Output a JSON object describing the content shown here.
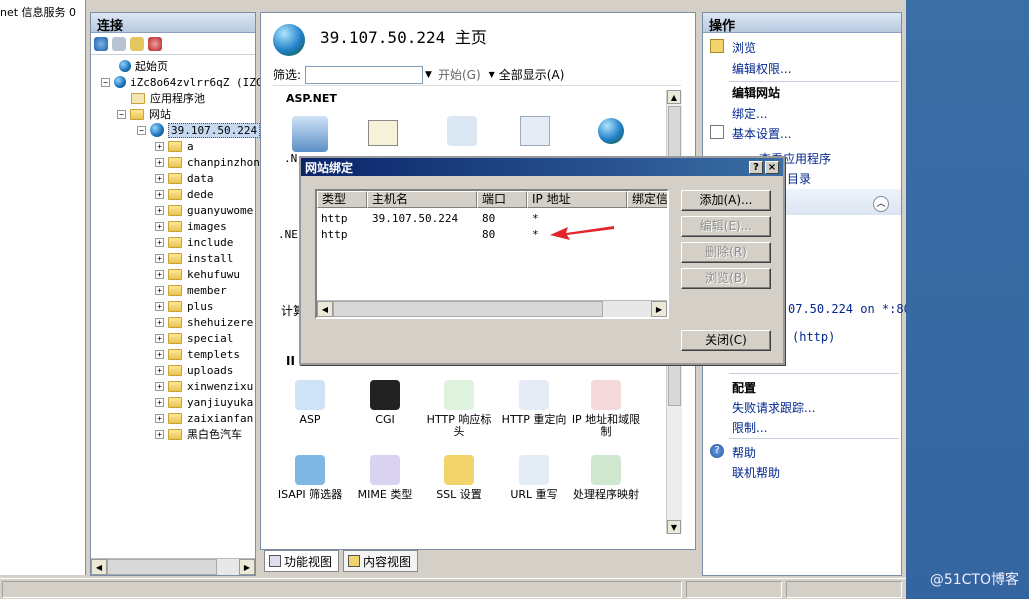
{
  "left_strip": {
    "text": "net 信息服务 0"
  },
  "connections": {
    "header": "连接",
    "tree": {
      "start_page": "起始页",
      "server": "iZc8o64zvlrr6qZ (IZC",
      "app_pools": "应用程序池",
      "sites": "网站",
      "site": "39.107.50.224",
      "folders": [
        "a",
        "chanpinzhon",
        "data",
        "dede",
        "guanyuwome",
        "images",
        "include",
        "install",
        "kehufuwu",
        "member",
        "plus",
        "shehuizere",
        "special",
        "templets",
        "uploads",
        "xinwenzixu",
        "yanjiuyuka",
        "zaixianfan",
        "黑白色汽车"
      ]
    }
  },
  "center": {
    "title": "39.107.50.224 主页",
    "filter_label": "筛选:",
    "start_button": "开始(G)",
    "show_all_button": "全部显示(A)",
    "group_aspnet": "ASP.NET",
    "partial_labels": {
      "net_left": ".N",
      "net_left2": ".NE",
      "calc": "计算",
      "iis_group": "II"
    },
    "iis_features_row1": [
      "ASP",
      "CGI",
      "HTTP 响应标头",
      "HTTP 重定向",
      "IP 地址和域限制"
    ],
    "iis_features_row2": [
      "ISAPI 筛选器",
      "MIME 类型",
      "SSL 设置",
      "URL 重写",
      "处理程序映射"
    ],
    "tab_features": "功能视图",
    "tab_content": "内容视图"
  },
  "actions": {
    "header": "操作",
    "browse": "浏览",
    "edit_permissions": "编辑权限...",
    "edit_site": "编辑网站",
    "bindings": "绑定...",
    "basic_settings": "基本设置...",
    "view_apps_partial": "查看应用程序",
    "view_vdirs_partial": "目录",
    "browse_binding_partial": "07.50.224 on *:80",
    "browse_http_partial": "(http)",
    "config_header": "配置",
    "failed_request_tracing": "失败请求跟踪...",
    "limits": "限制...",
    "help": "帮助",
    "online_help": "联机帮助"
  },
  "dialog": {
    "title": "网站绑定",
    "help_btn": "?",
    "close_btn": "×",
    "columns": [
      "类型",
      "主机名",
      "端口",
      "IP 地址",
      "绑定信"
    ],
    "rows": [
      {
        "type": "http",
        "host": "39.107.50.224",
        "port": "80",
        "ip": "*"
      },
      {
        "type": "http",
        "host": "",
        "port": "80",
        "ip": "*"
      }
    ],
    "buttons": {
      "add": "添加(A)...",
      "edit": "编辑(E)...",
      "remove": "删除(R)",
      "browse": "浏览(B)",
      "close": "关闭(C)"
    }
  },
  "watermark": "@51CTO博客",
  "colors": {
    "accent_title": "#0a246a",
    "link": "#03278e",
    "arrow": "#e0262b",
    "desktop": "#3a6ea5"
  }
}
